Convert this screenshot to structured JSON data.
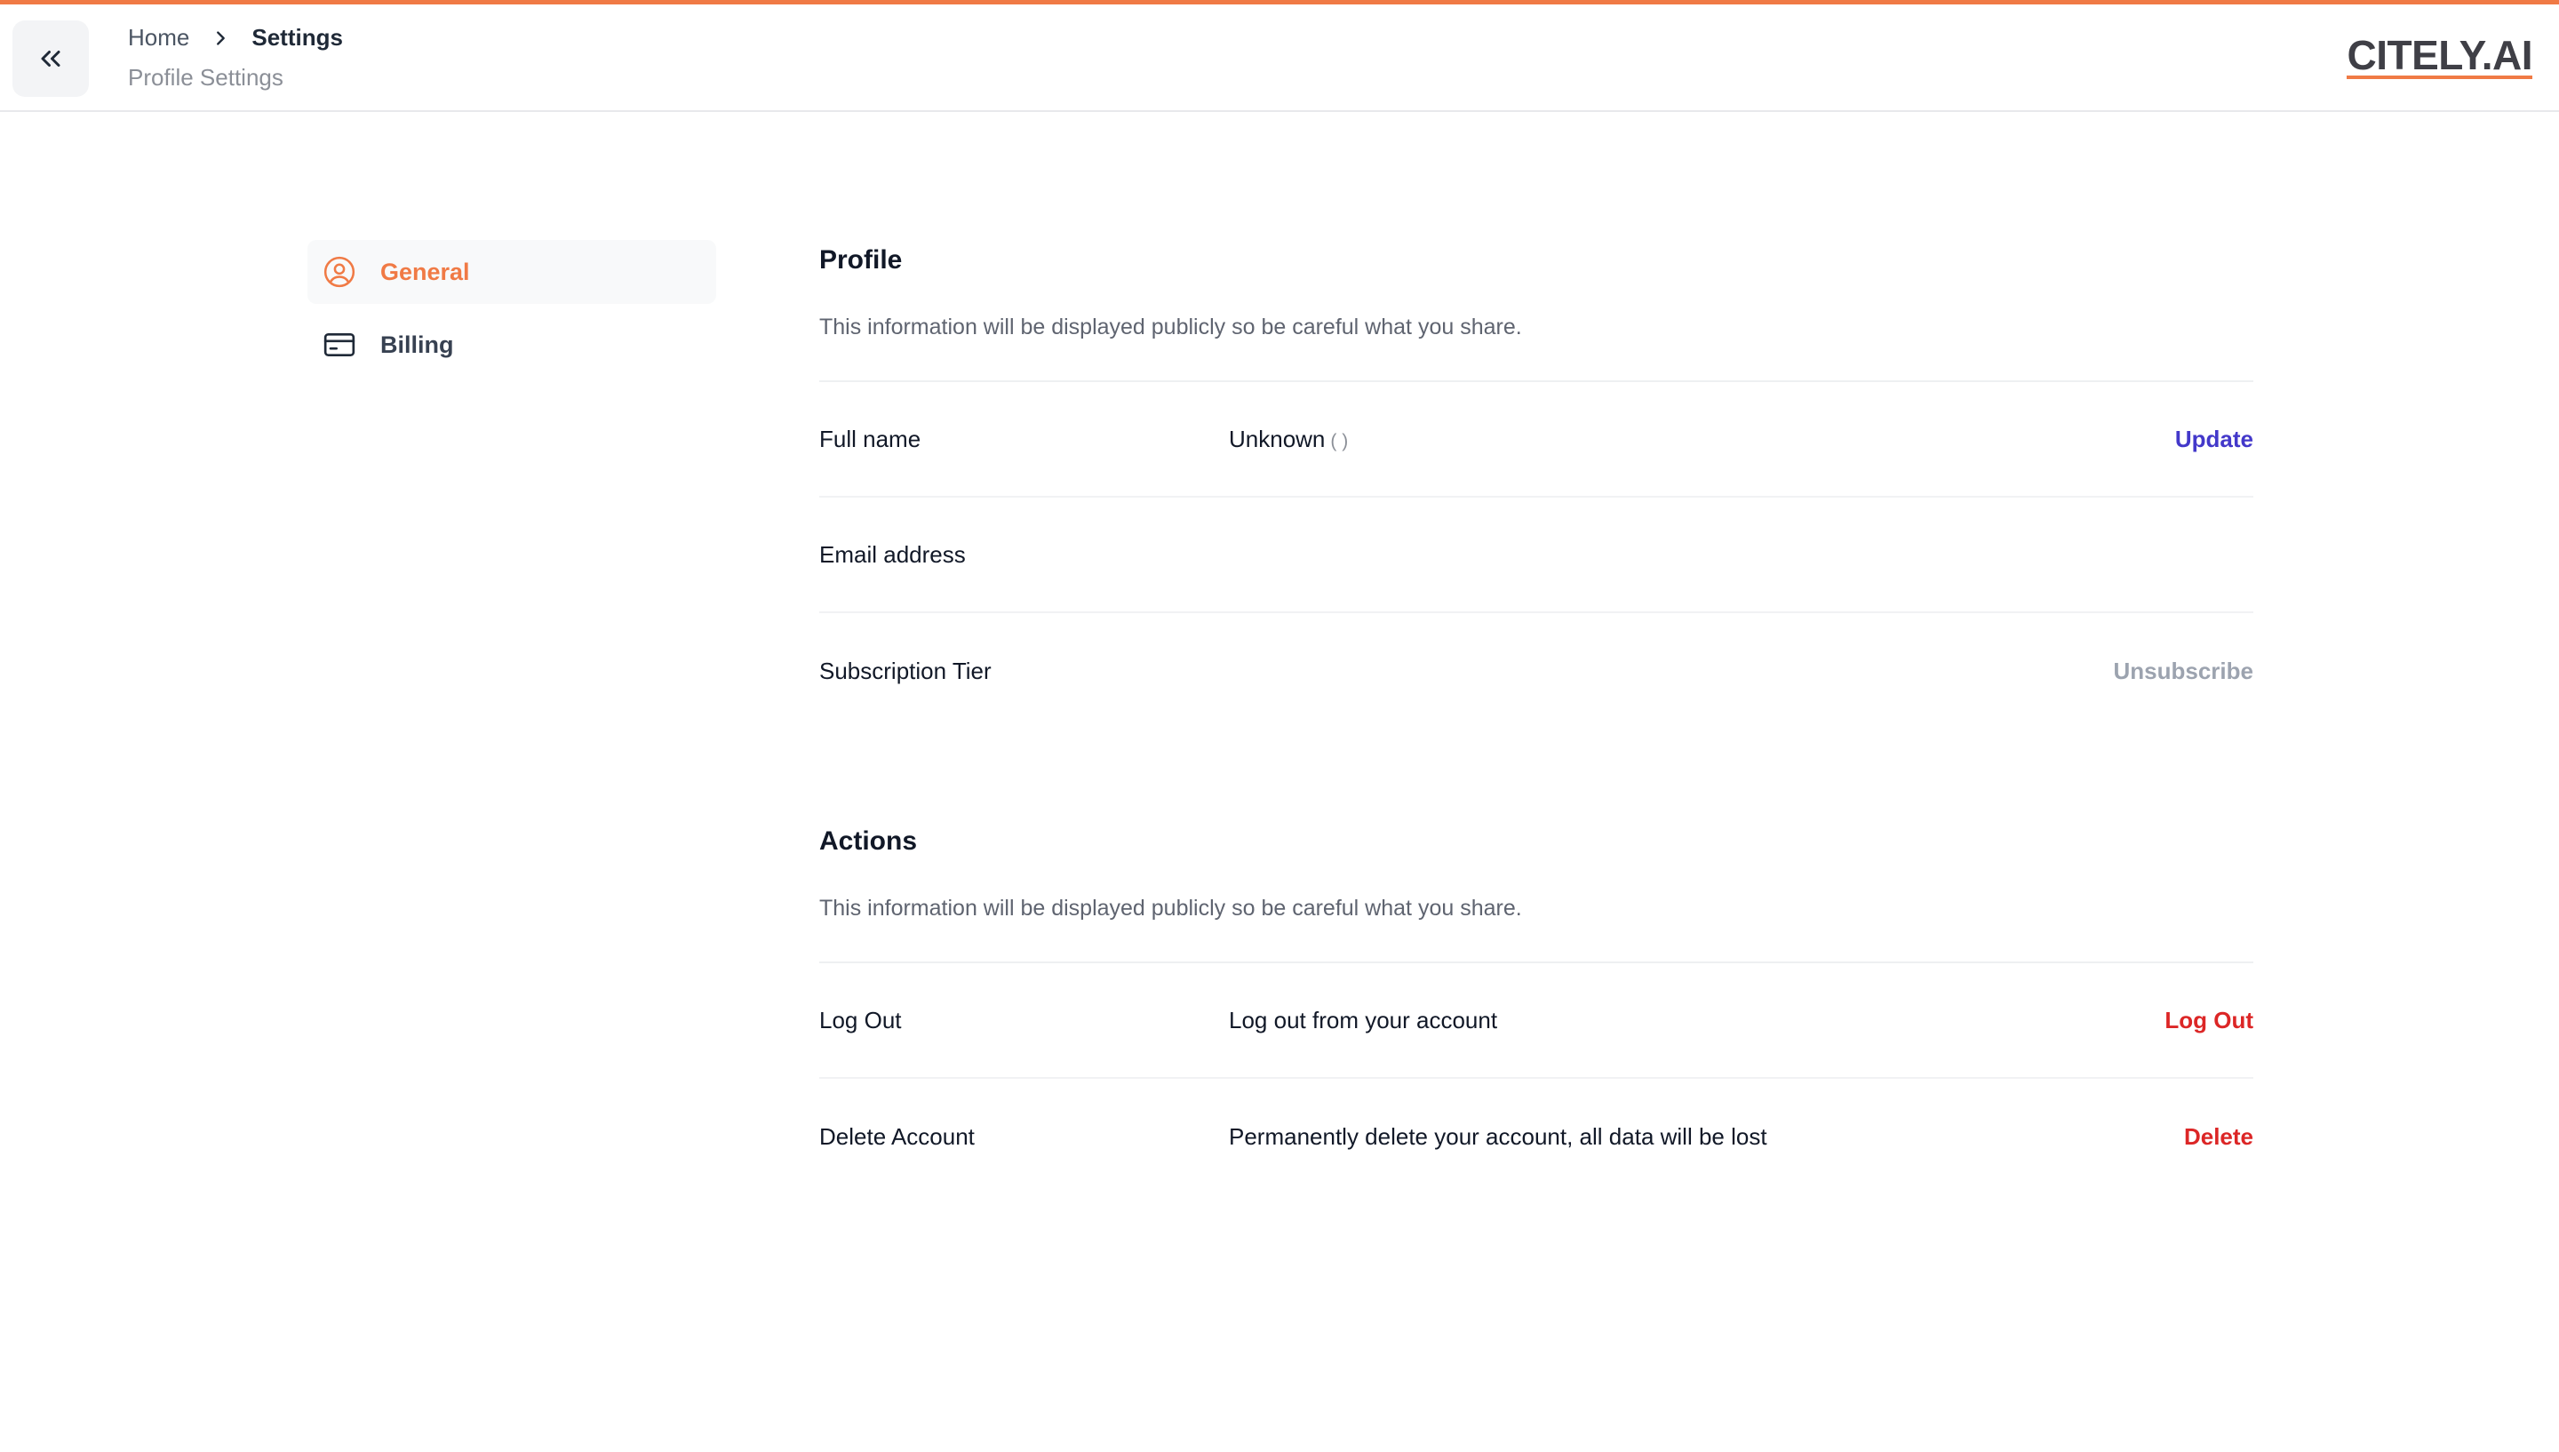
{
  "header": {
    "breadcrumb_home": "Home",
    "breadcrumb_current": "Settings",
    "subtitle": "Profile Settings",
    "logo": "CITELY.AI",
    "accent_color": "#f07a45"
  },
  "sidebar": {
    "items": [
      {
        "label": "General",
        "icon": "user-circle-icon",
        "active": true
      },
      {
        "label": "Billing",
        "icon": "credit-card-icon",
        "active": false
      }
    ]
  },
  "profile": {
    "title": "Profile",
    "description": "This information will be displayed publicly so be careful what you share.",
    "rows": [
      {
        "label": "Full name",
        "value": "Unknown",
        "value_extra": "( )",
        "action": "Update"
      },
      {
        "label": "Email address",
        "value": "",
        "action": ""
      },
      {
        "label": "Subscription Tier",
        "value": "",
        "action": "Unsubscribe"
      }
    ]
  },
  "actions": {
    "title": "Actions",
    "description": "This information will be displayed publicly so be careful what you share.",
    "rows": [
      {
        "label": "Log Out",
        "value": "Log out from your account",
        "action": "Log Out"
      },
      {
        "label": "Delete Account",
        "value": "Permanently delete your account, all data will be lost",
        "action": "Delete"
      }
    ]
  }
}
